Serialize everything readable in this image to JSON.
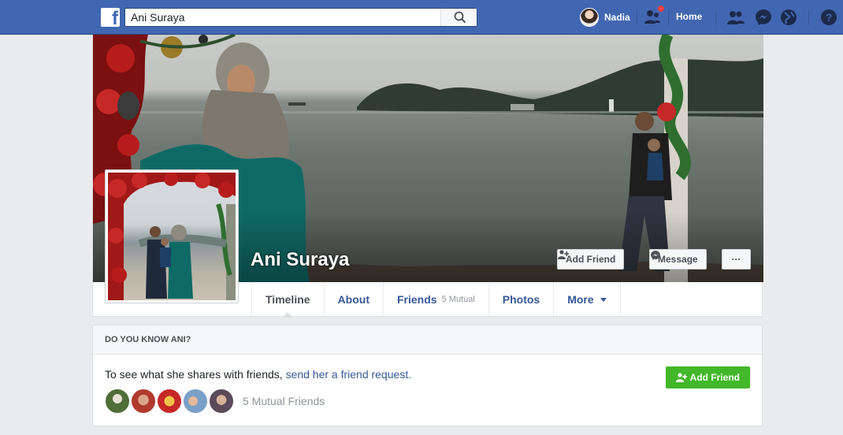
{
  "topbar": {
    "search_value": "Ani Suraya",
    "user_name": "Nadia",
    "home_label": "Home"
  },
  "profile": {
    "name": "Ani Suraya",
    "add_friend_label": "Add Friend",
    "message_label": "Message",
    "more_dots": "···"
  },
  "tabs": [
    {
      "label": "Timeline"
    },
    {
      "label": "About"
    },
    {
      "label": "Friends",
      "sub": "5 Mutual"
    },
    {
      "label": "Photos"
    },
    {
      "label": "More"
    }
  ],
  "know_card": {
    "header": "DO YOU KNOW ANI?",
    "text": "To see what she shares with friends, ",
    "link": "send her a friend request.",
    "add_friend_label": "Add Friend",
    "mutual_text": "5 Mutual Friends"
  },
  "colors": {
    "brand": "#4267b2",
    "link": "#365899",
    "green": "#42b72a",
    "notification": "#fa3e3e"
  }
}
